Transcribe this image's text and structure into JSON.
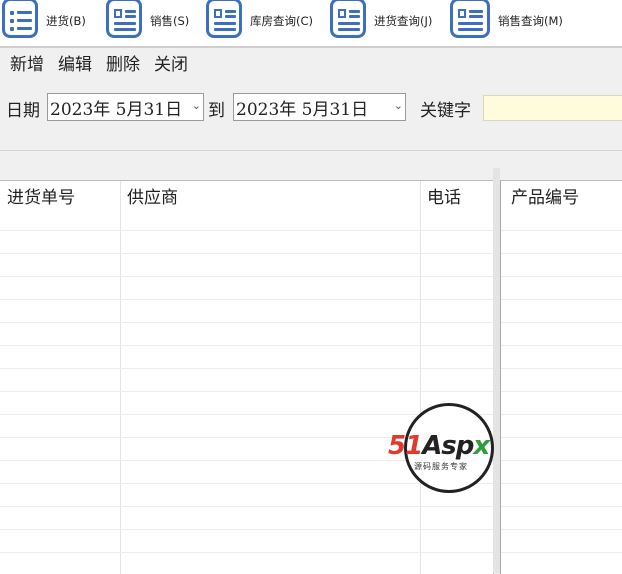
{
  "toolbar": {
    "items": [
      {
        "label": "进货(B)",
        "icon": "list-icon"
      },
      {
        "label": "销售(S)",
        "icon": "document-icon"
      },
      {
        "label": "库房查询(C)",
        "icon": "document-icon"
      },
      {
        "label": "进货查询(J)",
        "icon": "document-icon"
      },
      {
        "label": "销售查询(M)",
        "icon": "document-icon"
      }
    ]
  },
  "menu": {
    "new": "新增",
    "edit": "编辑",
    "delete": "删除",
    "close": "关闭"
  },
  "filter": {
    "date_label": "日期",
    "start_date": "2023年  5月31日",
    "to_label": "到",
    "end_date": "2023年  5月31日",
    "keyword_label": "关键字",
    "keyword_value": ""
  },
  "left_grid": {
    "columns": [
      "进货单号",
      "供应商",
      "电话"
    ]
  },
  "right_grid": {
    "columns": [
      "产品编号"
    ]
  },
  "watermark": {
    "brand_red": "51",
    "brand_dark": "Asp",
    "brand_green": "x",
    "tagline": "源码服务专家"
  },
  "colors": {
    "icon_blue": "#3d6fc0",
    "keyword_bg": "#fffbdc",
    "brand_red": "#e03a2f",
    "brand_green": "#2e9d3c"
  }
}
